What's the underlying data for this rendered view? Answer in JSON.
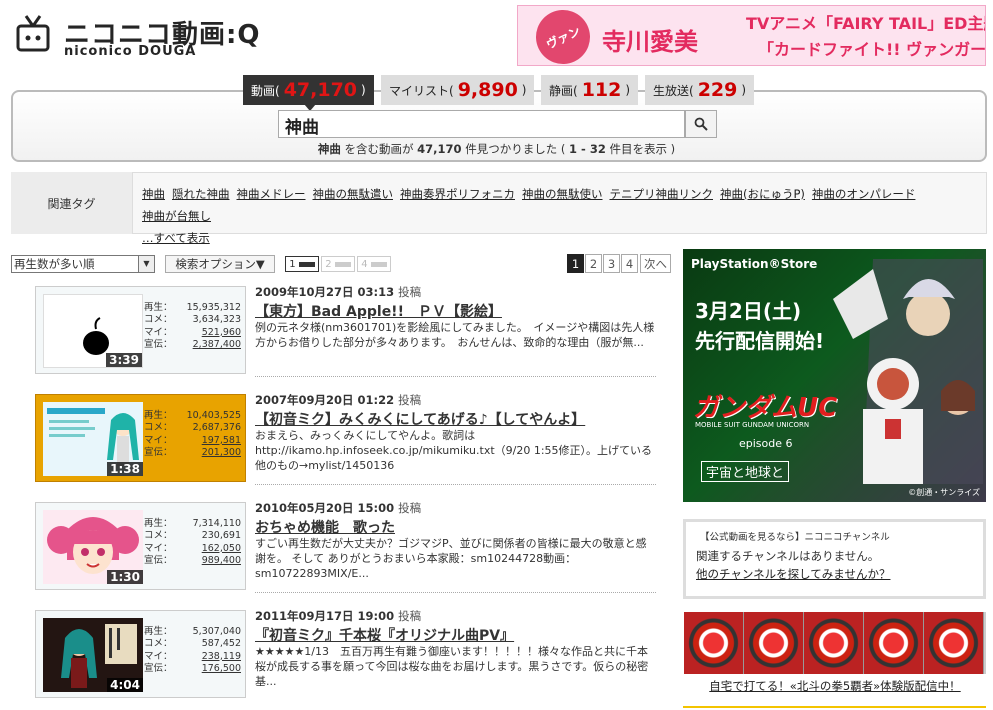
{
  "header": {
    "logo_text": "ニコニコ動画:Q",
    "logo_sub": "niconico DOUGA",
    "banner": {
      "circle_text": "ヴァン",
      "name": "寺川愛美",
      "line1": "TVアニメ「FAIRY TAIL」ED主題歌",
      "line2": "「カードファイト!! ヴァンガード」スイコ役"
    }
  },
  "tabs": [
    {
      "label": "動画(",
      "count": "47,170",
      "close": ")",
      "active": true
    },
    {
      "label": "マイリスト(",
      "count": "9,890",
      "close": ")",
      "active": false
    },
    {
      "label": "静画(",
      "count": "112",
      "close": ")",
      "active": false
    },
    {
      "label": "生放送(",
      "count": "229",
      "close": ")",
      "active": false
    }
  ],
  "search": {
    "query": "神曲",
    "result_keyword": "神曲",
    "result_mid": "を含む動画が",
    "result_count": "47,170",
    "result_post": "件見つかりました (",
    "result_range": "1 - 32",
    "result_end": "件目を表示 )"
  },
  "related_tags": {
    "label": "関連タグ",
    "tags": [
      "神曲",
      "隠れた神曲",
      "神曲メドレー",
      "神曲の無駄遣い",
      "神曲奏界ポリフォニカ",
      "神曲の無駄使い",
      "テニプリ神曲リンク",
      "神曲(おにゅうP)",
      "神曲のオンパレード",
      "神曲が台無し"
    ],
    "show_all": "…すべて表示"
  },
  "controls": {
    "sort": "再生数が多い順",
    "options": "検索オプション▼",
    "views": [
      "1",
      "2",
      "4"
    ],
    "pages": [
      "1",
      "2",
      "3",
      "4"
    ],
    "next": "次へ"
  },
  "stat_labels": {
    "play": "再生：",
    "comment": "コメ：",
    "mylist": "マイ：",
    "ad": "宣伝："
  },
  "videos": [
    {
      "date": "2009年10月27日 03:13",
      "posted": "投稿",
      "title": "【東方】Bad Apple!!　ＰＶ【影絵】",
      "desc": "例の元ネタ様(nm3601701)を影絵風にしてみました。　イメージや構図は先人様方からお借りした部分が多々あります。　おんせんは、致命的な理由（服が無...",
      "duration": "3:39",
      "play": "15,935,312",
      "comment": "3,634,323",
      "mylist": "521,960",
      "ad": "2,387,400"
    },
    {
      "date": "2007年09月20日 01:22",
      "posted": "投稿",
      "title": "【初音ミク】みくみくにしてあげる♪【してやんよ】",
      "desc": "おまえら、みっくみくにしてやんよ。歌詞は http://ikamo.hp.infoseek.co.jp/mikumiku.txt（9/20 1:55修正）。上げている他のもの→mylist/1450136",
      "duration": "1:38",
      "play": "10,403,525",
      "comment": "2,687,376",
      "mylist": "197,581",
      "ad": "201,300"
    },
    {
      "date": "2010年05月20日 15:00",
      "posted": "投稿",
      "title": "おちゃめ機能　歌った",
      "desc": "すごい再生数だが大丈夫か？ゴジマジP、並びに関係者の皆様に最大の敬意と感謝を。 そして ありがとうおまいら本家殿：sm10244728動画：sm10722893MIX/E...",
      "duration": "1:30",
      "play": "7,314,110",
      "comment": "230,691",
      "mylist": "162,050",
      "ad": "989,400"
    },
    {
      "date": "2011年09月17日 19:00",
      "posted": "投稿",
      "title": "『初音ミク』千本桜『オリジナル曲PV』",
      "desc": "★★★★★1/13　五百万再生有難う御座います！！！！！様々な作品と共に千本桜が成長する事を願って今回は桜な曲をお届けします。黒うさです。仮らの秘密基...",
      "duration": "4:04",
      "play": "5,307,040",
      "comment": "587,452",
      "mylist": "238,119",
      "ad": "176,500"
    }
  ],
  "sidebar": {
    "ad": {
      "store": "PlayStation®Store",
      "date1": "3月2日(土)",
      "date2": "先行配信開始!",
      "logo": "ガンダムUC",
      "logo_sub": "MOBILE SUIT GUNDAM UNICORN",
      "episode": "episode 6",
      "episode_title": "宇宙と地球と",
      "copyright": "©創通・サンライズ"
    },
    "channel": {
      "header": "【公式動画を見るなら】ニコニコチャンネル",
      "line1": "関連するチャンネルはありません。",
      "link": "他のチャンネルを探してみませんか？"
    },
    "pachinko_link": "自宅で打てる！«北斗の拳5覇者»体験版配信中！"
  }
}
